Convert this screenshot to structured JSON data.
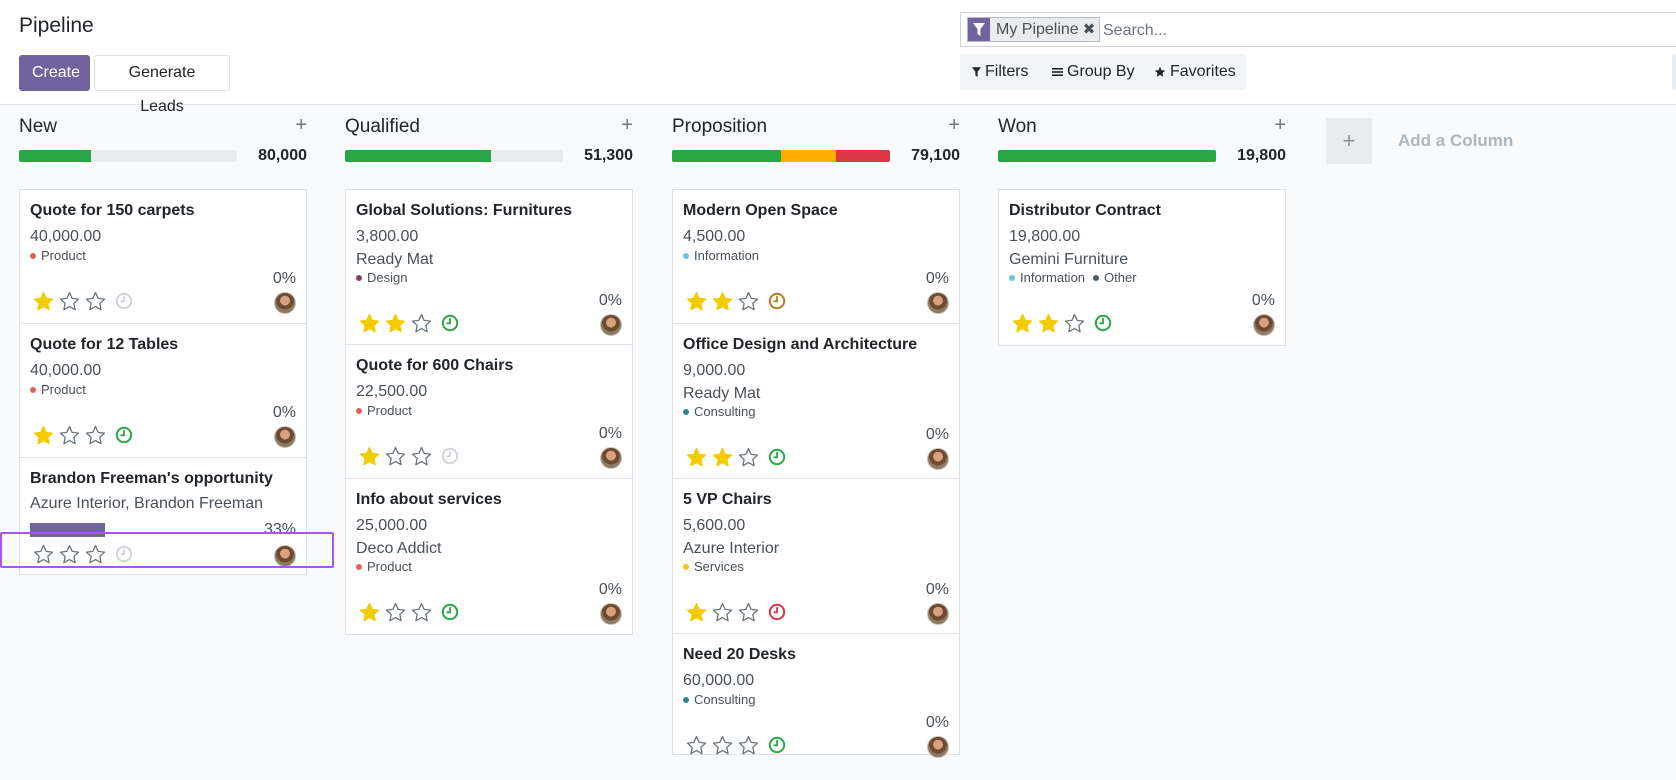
{
  "header": {
    "title": "Pipeline",
    "create_label": "Create",
    "generate_leads_label": "Generate Leads"
  },
  "search": {
    "facet_label": "My Pipeline",
    "placeholder": "Search...",
    "filters_label": "Filters",
    "groupby_label": "Group By",
    "favorites_label": "Favorites"
  },
  "columns": [
    {
      "title": "New",
      "total": "80,000",
      "progress": [
        {
          "color": "#28a745",
          "fraction": 0.33
        }
      ],
      "cards": [
        {
          "title": "Quote for 150 carpets",
          "revenue": "40,000.00",
          "tags": [
            {
              "label": "Product",
              "color": "#e0625c"
            }
          ],
          "probability": "0%",
          "stars": 1,
          "activity": "none"
        },
        {
          "title": "Quote for 12 Tables",
          "revenue": "40,000.00",
          "tags": [
            {
              "label": "Product",
              "color": "#e0625c"
            }
          ],
          "probability": "0%",
          "stars": 1,
          "activity": "ok"
        },
        {
          "title": "Brandon Freeman's opportunity",
          "subtitle": "Azure Interior, Brandon Freeman",
          "quick_progress": "33%",
          "stars": 0,
          "activity": "none"
        }
      ]
    },
    {
      "title": "Qualified",
      "total": "51,300",
      "progress": [
        {
          "color": "#28a745",
          "fraction": 0.67
        }
      ],
      "cards": [
        {
          "title": "Global Solutions: Furnitures",
          "revenue": "3,800.00",
          "partner": "Ready Mat",
          "tags": [
            {
              "label": "Design",
              "color": "#8a3f6a"
            }
          ],
          "probability": "0%",
          "stars": 2,
          "activity": "ok"
        },
        {
          "title": "Quote for 600 Chairs",
          "revenue": "22,500.00",
          "tags": [
            {
              "label": "Product",
              "color": "#e0625c"
            }
          ],
          "probability": "0%",
          "stars": 1,
          "activity": "none"
        },
        {
          "title": "Info about services",
          "revenue": "25,000.00",
          "partner": "Deco Addict",
          "tags": [
            {
              "label": "Product",
              "color": "#e0625c"
            }
          ],
          "probability": "0%",
          "stars": 1,
          "activity": "ok"
        }
      ]
    },
    {
      "title": "Proposition",
      "total": "79,100",
      "progress": [
        {
          "color": "#28a745",
          "fraction": 0.5
        },
        {
          "color": "#ffac00",
          "fraction": 0.25
        },
        {
          "color": "#dc3545",
          "fraction": 0.25
        }
      ],
      "cards": [
        {
          "title": "Modern Open Space",
          "revenue": "4,500.00",
          "tags": [
            {
              "label": "Information",
              "color": "#6cc1ed"
            }
          ],
          "probability": "0%",
          "stars": 2,
          "activity": "warn"
        },
        {
          "title": "Office Design and Architecture",
          "revenue": "9,000.00",
          "partner": "Ready Mat",
          "tags": [
            {
              "label": "Consulting",
              "color": "#2c8397"
            }
          ],
          "probability": "0%",
          "stars": 2,
          "activity": "ok"
        },
        {
          "title": "5 VP Chairs",
          "revenue": "5,600.00",
          "partner": "Azure Interior",
          "tags": [
            {
              "label": "Services",
              "color": "#f5c32f"
            }
          ],
          "probability": "0%",
          "stars": 1,
          "activity": "late"
        },
        {
          "title": "Need 20 Desks",
          "revenue": "60,000.00",
          "tags": [
            {
              "label": "Consulting",
              "color": "#2c8397"
            }
          ],
          "probability": "0%",
          "stars": 0,
          "activity": "ok"
        }
      ]
    },
    {
      "title": "Won",
      "total": "19,800",
      "progress": [
        {
          "color": "#28a745",
          "fraction": 1.0
        }
      ],
      "cards": [
        {
          "title": "Distributor Contract",
          "revenue": "19,800.00",
          "partner": "Gemini Furniture",
          "tags": [
            {
              "label": "Information",
              "color": "#6cc1ed"
            },
            {
              "label": "Other",
              "color": "#4c5b74"
            }
          ],
          "probability": "0%",
          "stars": 2,
          "activity": "ok"
        }
      ]
    }
  ],
  "add_column_label": "Add a Column",
  "colors": {
    "primary": "#71639e",
    "star": "#f3cc00",
    "activity_ok": "#28a745",
    "activity_warn": "#b08020",
    "activity_late": "#dc3545"
  }
}
